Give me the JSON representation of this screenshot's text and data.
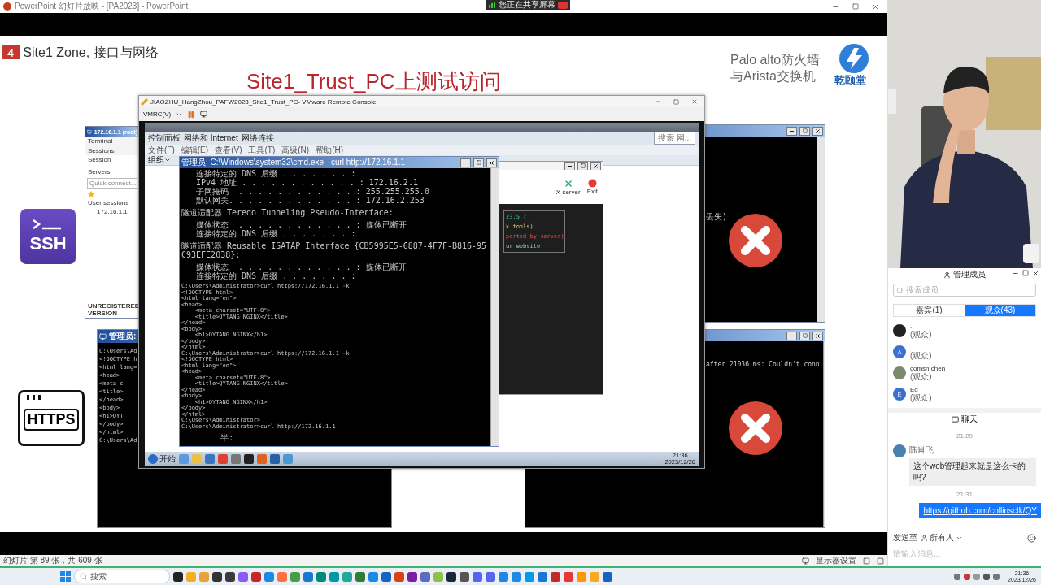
{
  "ppt": {
    "title": "PowerPoint 幻灯片放映 - [PA2023] - PowerPoint"
  },
  "share_banner": {
    "text": "您正在共享屏幕"
  },
  "slide": {
    "section_number": "4",
    "section_title": "Site1 Zone, 接口与网络",
    "brand_lines": [
      "Palo alto防火墙",
      "与Arista交换机"
    ],
    "brand_name": "乾颐堂",
    "title": "Site1_Trust_PC上测试访问",
    "badges": [
      {
        "kind": "ssh",
        "label": "SSH"
      },
      {
        "kind": "https",
        "label": "HTTPS"
      }
    ]
  },
  "moba_window": {
    "title": "172.16.1.1 (root)",
    "menu": [
      "Terminal",
      "Sessions"
    ],
    "tools": [
      "Session",
      "Servers"
    ],
    "quick_connect": "Quick connect...",
    "tree_root": "User sessions",
    "session": "172.16.1.1",
    "footer": "UNREGISTERED VERSION"
  },
  "back_cmd": {
    "title": "管理员:",
    "lines": [
      "C:\\Users\\Ad",
      "<!DOCTYPE h",
      "<html lang=",
      "<head>",
      "    <meta c",
      "    <title>",
      "</head>",
      "<body>",
      "    <h1>QYT",
      "</body>",
      "</html>",
      "C:\\Users\\Ad"
    ]
  },
  "error_terminals": [
    {
      "text": "丢失)"
    },
    {
      "text": "after 21036 ms: Couldn't conn"
    }
  ],
  "vmrc": {
    "title": "JIAOZHU_HangZhou_PAFW2023_Site1_Trust_PC- VMware Remote Console",
    "menu": "VMRC(V)",
    "explorer": {
      "path": [
        "控制面板",
        "网络和 Internet",
        "网络连接"
      ],
      "search_placeholder": "搜索 网...",
      "menu": [
        "文件(F)",
        "编辑(E)",
        "查看(V)",
        "工具(T)",
        "高级(N)",
        "帮助(H)"
      ],
      "organize": "组织"
    },
    "inner_moba": {
      "buttons": [
        "X server",
        "Exit"
      ],
      "lines": [
        "23.5 ?",
        "k tools)",
        "ported by server)",
        "ur website."
      ]
    },
    "cmd": {
      "title": "管理员: C:\\Windows\\system32\\cmd.exe - curl http://172.16.1.1",
      "blocks": [
        [
          "   连接特定的 DNS 后缀 . . . . . . . :",
          "   IPv4 地址 . . . . . . . . . . . . : 172.16.2.1",
          "   子网掩码  . . . . . . . . . . . . : 255.255.255.0",
          "   默认网关. . . . . . . . . . . . . : 172.16.2.253"
        ],
        [
          "隧道适配器 Teredo Tunneling Pseudo-Interface:"
        ],
        [
          "   媒体状态  . . . . . . . . . . . . : 媒体已断开",
          "   连接特定的 DNS 后缀 . . . . . . . :"
        ],
        [
          "隧道适配器 Reusable ISATAP Interface {CB5995E5-6887-4F7F-B816-95C93EFE2038}:"
        ],
        [
          "   媒体状态  . . . . . . . . . . . . : 媒体已断开",
          "   连接特定的 DNS 后缀 . . . . . . . :"
        ],
        [
          "C:\\Users\\Administrator>curl https://172.16.1.1 -k",
          "<!DOCTYPE html>",
          "<html lang=\"en\">",
          "<head>",
          "    <meta charset=\"UTF-8\">",
          "    <title>QYTANG NGINX</title>",
          "</head>",
          "<body>",
          "    <h1>QYTANG NGINX</h1>",
          "</body>",
          "</html>",
          "C:\\Users\\Administrator>curl https://172.16.1.1 -k",
          "<!DOCTYPE html>",
          "<html lang=\"en\">",
          "<head>",
          "    <meta charset=\"UTF-8\">",
          "    <title>QYTANG NGINX</title>",
          "</head>",
          "<body>",
          "    <h1>QYTANG NGINX</h1>",
          "</body>",
          "</html>",
          "C:\\Users\\Administrator>",
          "C:\\Users\\Administrator>curl http://172.16.1.1"
        ],
        [
          "        半:"
        ]
      ]
    },
    "taskbar": {
      "start": "开始",
      "time": "21:36",
      "date": "2023/12/26"
    }
  },
  "members": {
    "title": "管理成员",
    "search_placeholder": "搜索成员",
    "tabs": [
      {
        "label": "嘉宾(1)",
        "selected": false
      },
      {
        "label": "观众(43)",
        "selected": true
      }
    ],
    "list": [
      {
        "name": ".",
        "role": "(观众)"
      },
      {
        "name": ".",
        "role": "(观众)",
        "avatar": {
          "kind": "letter",
          "initial": "A"
        }
      },
      {
        "name": "comsn.chen",
        "role": "(观众)"
      },
      {
        "name": "Ed",
        "role": "(观众)",
        "avatar": {
          "kind": "letter",
          "initial": "E"
        }
      }
    ]
  },
  "chat": {
    "title": "聊天",
    "items": [
      {
        "kind": "time",
        "text": "21:20"
      },
      {
        "kind": "message",
        "sender": "陈肖飞",
        "text": "这个web管理起来就是这么卡的吗?"
      },
      {
        "kind": "time",
        "text": "21:31"
      },
      {
        "kind": "own_link",
        "text": "https://github.com/collinsctk/QY"
      }
    ],
    "send_to_label": "发送至",
    "recipient": "所有人",
    "input_placeholder": "请输入消息..."
  },
  "status_bar": {
    "slide_info": "幻灯片 第 89 张，共 609 张",
    "display_settings": "显示器设置"
  },
  "taskbar": {
    "search_placeholder": "搜索",
    "time": "21:36",
    "date": "2023/12/26"
  }
}
